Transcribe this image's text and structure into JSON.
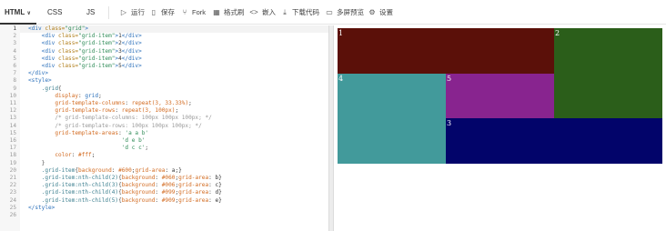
{
  "tabs": {
    "html": "HTML",
    "css": "CSS",
    "js": "JS"
  },
  "toolbar": [
    {
      "icon": "play-icon",
      "glyph": "▷",
      "label": "运行"
    },
    {
      "icon": "save-icon",
      "glyph": "🗎",
      "label": "保存"
    },
    {
      "icon": "fork-icon",
      "glyph": "⑂",
      "label": "Fork"
    },
    {
      "icon": "format-icon",
      "glyph": "▦",
      "label": "格式刷"
    },
    {
      "icon": "embed-icon",
      "glyph": "<>",
      "label": "嵌入"
    },
    {
      "icon": "download-icon",
      "glyph": "⤓",
      "label": "下载代码"
    },
    {
      "icon": "multiscreen-icon",
      "glyph": "▭",
      "label": "多屏预览"
    },
    {
      "icon": "settings-icon",
      "glyph": "⚙",
      "label": "设置"
    }
  ],
  "editor": {
    "line_numbers": [
      "1",
      "2",
      "3",
      "4",
      "5",
      "6",
      "7",
      "8",
      "9",
      "10",
      "11",
      "12",
      "13",
      "14",
      "15",
      "16",
      "17",
      "18",
      "19",
      "20",
      "21",
      "22",
      "23",
      "24",
      "25",
      "26"
    ],
    "lines": [
      [
        {
          "t": "<div ",
          "c": "tg"
        },
        {
          "t": "class=",
          "c": "at"
        },
        {
          "t": "\"grid\"",
          "c": "st"
        },
        {
          "t": ">",
          "c": "tg"
        }
      ],
      [
        {
          "t": "    <div ",
          "c": "tg"
        },
        {
          "t": "class=",
          "c": "at"
        },
        {
          "t": "\"grid-item\"",
          "c": "st"
        },
        {
          "t": ">",
          "c": "tg"
        },
        {
          "t": "1",
          "c": ""
        },
        {
          "t": "</div>",
          "c": "tg"
        }
      ],
      [
        {
          "t": "    <div ",
          "c": "tg"
        },
        {
          "t": "class=",
          "c": "at"
        },
        {
          "t": "\"grid-item\"",
          "c": "st"
        },
        {
          "t": ">",
          "c": "tg"
        },
        {
          "t": "2",
          "c": ""
        },
        {
          "t": "</div>",
          "c": "tg"
        }
      ],
      [
        {
          "t": "    <div ",
          "c": "tg"
        },
        {
          "t": "class=",
          "c": "at"
        },
        {
          "t": "\"grid-item\"",
          "c": "st"
        },
        {
          "t": ">",
          "c": "tg"
        },
        {
          "t": "3",
          "c": ""
        },
        {
          "t": "</div>",
          "c": "tg"
        }
      ],
      [
        {
          "t": "    <div ",
          "c": "tg"
        },
        {
          "t": "class=",
          "c": "at"
        },
        {
          "t": "\"grid-item\"",
          "c": "st"
        },
        {
          "t": ">",
          "c": "tg"
        },
        {
          "t": "4",
          "c": ""
        },
        {
          "t": "</div>",
          "c": "tg"
        }
      ],
      [
        {
          "t": "    <div ",
          "c": "tg"
        },
        {
          "t": "class=",
          "c": "at"
        },
        {
          "t": "\"grid-item\"",
          "c": "st"
        },
        {
          "t": ">",
          "c": "tg"
        },
        {
          "t": "5",
          "c": ""
        },
        {
          "t": "</div>",
          "c": "tg"
        }
      ],
      [
        {
          "t": "</div>",
          "c": "tg"
        }
      ],
      [
        {
          "t": "<style>",
          "c": "tg"
        }
      ],
      [
        {
          "t": "    .grid",
          "c": "sel"
        },
        {
          "t": "{",
          "c": "bk"
        }
      ],
      [
        {
          "t": "        display",
          "c": "pr"
        },
        {
          "t": ": ",
          "c": ""
        },
        {
          "t": "grid",
          "c": "vl"
        },
        {
          "t": ";",
          "c": ""
        }
      ],
      [
        {
          "t": "        grid-template-columns",
          "c": "pr"
        },
        {
          "t": ": ",
          "c": ""
        },
        {
          "t": "repeat(3, 33.33%)",
          "c": "pr"
        },
        {
          "t": ";",
          "c": ""
        }
      ],
      [
        {
          "t": "        grid-template-rows",
          "c": "pr"
        },
        {
          "t": ": ",
          "c": ""
        },
        {
          "t": "repeat(3, 100px)",
          "c": "pr"
        },
        {
          "t": ";",
          "c": ""
        }
      ],
      [
        {
          "t": "        /* grid-template-columns: 100px 100px 100px; */",
          "c": "cm"
        }
      ],
      [
        {
          "t": "        /* grid-template-rows: 100px 100px 100px; */",
          "c": "cm"
        }
      ],
      [
        {
          "t": "        grid-template-areas",
          "c": "pr"
        },
        {
          "t": ": ",
          "c": ""
        },
        {
          "t": "'a a b'",
          "c": "st"
        }
      ],
      [
        {
          "t": "                            ",
          "c": ""
        },
        {
          "t": "'d e b'",
          "c": "st"
        }
      ],
      [
        {
          "t": "                            ",
          "c": ""
        },
        {
          "t": "'d c c'",
          "c": "st"
        },
        {
          "t": ";",
          "c": ""
        }
      ],
      [
        {
          "t": "        color",
          "c": "pr"
        },
        {
          "t": ": ",
          "c": ""
        },
        {
          "t": "#fff",
          "c": "pr"
        },
        {
          "t": ";",
          "c": ""
        }
      ],
      [
        {
          "t": "    }",
          "c": "bk"
        }
      ],
      [
        {
          "t": "    .grid-item",
          "c": "sel"
        },
        {
          "t": "{",
          "c": "bk"
        },
        {
          "t": "background",
          "c": "pr"
        },
        {
          "t": ": ",
          "c": ""
        },
        {
          "t": "#600",
          "c": "pr"
        },
        {
          "t": ";",
          "c": ""
        },
        {
          "t": "grid-area",
          "c": "pr"
        },
        {
          "t": ": a;}",
          "c": ""
        }
      ],
      [
        {
          "t": "    .grid-item:nth-child(2)",
          "c": "sel"
        },
        {
          "t": "{",
          "c": "bk"
        },
        {
          "t": "background",
          "c": "pr"
        },
        {
          "t": ": ",
          "c": ""
        },
        {
          "t": "#060",
          "c": "pr"
        },
        {
          "t": ";",
          "c": ""
        },
        {
          "t": "grid-area",
          "c": "pr"
        },
        {
          "t": ": b}",
          "c": ""
        }
      ],
      [
        {
          "t": "    .grid-item:nth-child(3)",
          "c": "sel"
        },
        {
          "t": "{",
          "c": "bk"
        },
        {
          "t": "background",
          "c": "pr"
        },
        {
          "t": ": ",
          "c": ""
        },
        {
          "t": "#006",
          "c": "pr"
        },
        {
          "t": ";",
          "c": ""
        },
        {
          "t": "grid-area",
          "c": "pr"
        },
        {
          "t": ": c}",
          "c": ""
        }
      ],
      [
        {
          "t": "    .grid-item:nth-child(4)",
          "c": "sel"
        },
        {
          "t": "{",
          "c": "bk"
        },
        {
          "t": "background",
          "c": "pr"
        },
        {
          "t": ": ",
          "c": ""
        },
        {
          "t": "#099",
          "c": "pr"
        },
        {
          "t": ";",
          "c": ""
        },
        {
          "t": "grid-area",
          "c": "pr"
        },
        {
          "t": ": d}",
          "c": ""
        }
      ],
      [
        {
          "t": "    .grid-item:nth-child(5)",
          "c": "sel"
        },
        {
          "t": "{",
          "c": "bk"
        },
        {
          "t": "background",
          "c": "pr"
        },
        {
          "t": ": ",
          "c": ""
        },
        {
          "t": "#909",
          "c": "pr"
        },
        {
          "t": ";",
          "c": ""
        },
        {
          "t": "grid-area",
          "c": "pr"
        },
        {
          "t": ": e}",
          "c": ""
        }
      ],
      [
        {
          "t": "</style>",
          "c": "tg"
        }
      ],
      [
        {
          "t": "",
          "c": ""
        }
      ]
    ]
  },
  "preview": {
    "items": [
      {
        "label": "1",
        "area": "a",
        "color": "#5b1009"
      },
      {
        "label": "2",
        "area": "b",
        "color": "#2b5e1a"
      },
      {
        "label": "3",
        "area": "c",
        "color": "#02046a"
      },
      {
        "label": "4",
        "area": "d",
        "color": "#429a9b"
      },
      {
        "label": "5",
        "area": "e",
        "color": "#88248f"
      }
    ]
  }
}
